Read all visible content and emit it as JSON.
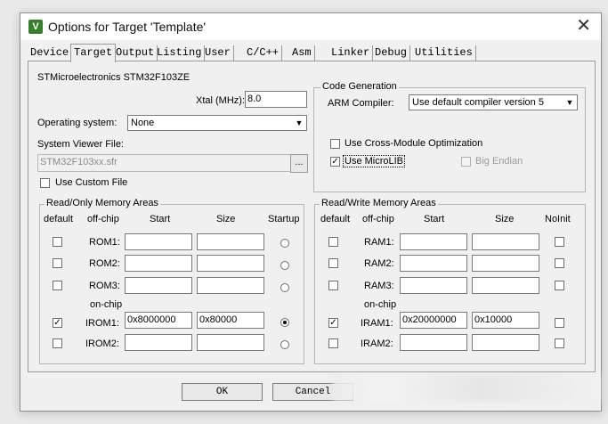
{
  "window": {
    "title": "Options for Target 'Template'",
    "icon_letter": "V",
    "close_glyph": "✕"
  },
  "tabs": [
    "Device",
    "Target",
    "Output",
    "Listing",
    "User",
    "C/C++",
    "Asm",
    "Linker",
    "Debug",
    "Utilities"
  ],
  "active_tab": "Target",
  "target": {
    "device": "STMicroelectronics STM32F103ZE",
    "xtal_label": "Xtal (MHz):",
    "xtal_value": "8.0",
    "os_label": "Operating system:",
    "os_value": "None",
    "svf_label": "System Viewer File:",
    "svf_value": "STM32F103xx.sfr",
    "browse_label": "...",
    "custom_file_label": "Use Custom File",
    "custom_file_checked": false
  },
  "code_generation": {
    "title": "Code Generation",
    "compiler_label": "ARM Compiler:",
    "compiler_value": "Use default compiler version 5",
    "cross_module_label": "Use Cross-Module Optimization",
    "cross_module_checked": false,
    "microlib_label": "Use MicroLIB",
    "microlib_checked": true,
    "big_endian_label": "Big Endian",
    "big_endian_checked": false
  },
  "rom": {
    "title": "Read/Only Memory Areas",
    "headers": {
      "default": "default",
      "offchip": "off-chip",
      "start": "Start",
      "size": "Size",
      "startup": "Startup"
    },
    "onchip_label": "on-chip",
    "rows": [
      {
        "name": "ROM1:",
        "start": "",
        "size": "",
        "default": false,
        "startup": false
      },
      {
        "name": "ROM2:",
        "start": "",
        "size": "",
        "default": false,
        "startup": false
      },
      {
        "name": "ROM3:",
        "start": "",
        "size": "",
        "default": false,
        "startup": false
      },
      {
        "name": "IROM1:",
        "start": "0x8000000",
        "size": "0x80000",
        "default": true,
        "startup": true
      },
      {
        "name": "IROM2:",
        "start": "",
        "size": "",
        "default": false,
        "startup": false
      }
    ]
  },
  "ram": {
    "title": "Read/Write Memory Areas",
    "headers": {
      "default": "default",
      "offchip": "off-chip",
      "start": "Start",
      "size": "Size",
      "noinit": "NoInit"
    },
    "onchip_label": "on-chip",
    "rows": [
      {
        "name": "RAM1:",
        "start": "",
        "size": "",
        "default": false,
        "noinit": false
      },
      {
        "name": "RAM2:",
        "start": "",
        "size": "",
        "default": false,
        "noinit": false
      },
      {
        "name": "RAM3:",
        "start": "",
        "size": "",
        "default": false,
        "noinit": false
      },
      {
        "name": "IRAM1:",
        "start": "0x20000000",
        "size": "0x10000",
        "default": true,
        "noinit": false
      },
      {
        "name": "IRAM2:",
        "start": "",
        "size": "",
        "default": false,
        "noinit": false
      }
    ]
  },
  "buttons": {
    "ok": "OK",
    "cancel": "Cancel"
  },
  "icons": [
    "app-icon",
    "close-icon",
    "chevron-down-icon",
    "check-icon"
  ],
  "colors": {
    "app_icon": "#3a7d2c",
    "dialog_bg": "#f0f0f0"
  }
}
